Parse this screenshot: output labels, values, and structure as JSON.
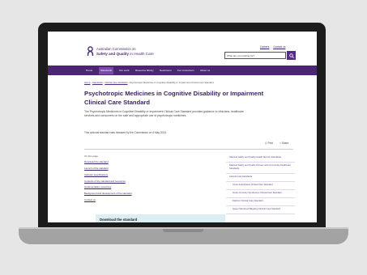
{
  "brand": {
    "line1": "Australian Commission on",
    "line2_bold": "Safety and Quality",
    "line2_rest": " in Health Care",
    "color": "#4b2c7a"
  },
  "utility_links": [
    "Careers",
    "Contact us"
  ],
  "search": {
    "placeholder": "What are you looking for?",
    "icon": "search-icon"
  },
  "nav": {
    "color": "#4a2770",
    "items": [
      "Home",
      "Standards",
      "Our work",
      "Resource library",
      "Newsroom",
      "For consumers",
      "About us"
    ],
    "active_index": 1
  },
  "breadcrumb": [
    "Home",
    "Standards",
    "Clinical care standards",
    "Psychotropic Medicines in Cognitive Disability or Impairment Clinical Care Standard"
  ],
  "page": {
    "title": "Psychotropic Medicines in Cognitive Disability or Impairment Clinical Care Standard",
    "intro": "The Psychotropic Medicines in Cognitive Disability or Impairment Clinical Care Standard provides guidance to clinicians, healthcare services and consumers on the safe and appropriate use of psychotropic medicines.",
    "note": "This optional standard was released by the Commission on 6 May 2024.",
    "print_label": "Print",
    "share_label": "Share"
  },
  "toc": {
    "heading": "On this page",
    "items": [
      "Download the standard",
      "Launch of the standard",
      "Indicator specifications",
      "Contents of the standard and resources",
      "Implementation resources",
      "Background and development of the standard",
      "Contact us"
    ]
  },
  "sidebar": [
    "National Safety and Quality Health Service Standards",
    "National Safety and Quality Primary and Community Healthcare Standards",
    "Clinical Care Standards",
    "Acute Anaphylaxis Clinical Care Standard",
    "Acute Coronary Syndromes Clinical Care Standard",
    "Delirium Clinical Care Standard",
    "Heavy Menstrual Bleeding Clinical Care Standard"
  ],
  "download": {
    "label": "Download the standard",
    "bg": "#dbeff3"
  }
}
